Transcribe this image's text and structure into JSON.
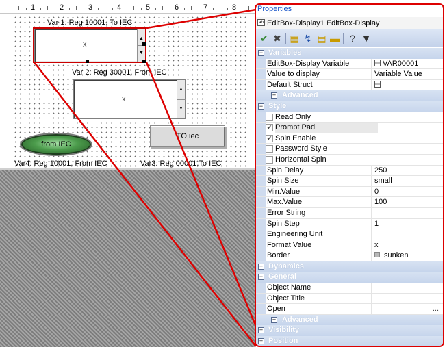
{
  "designer": {
    "ruler_numbers": [
      "1",
      "2",
      "3",
      "4",
      "5",
      "6",
      "7",
      "8"
    ],
    "var1_label": "Var 1: Reg 10001, To IEC",
    "var2_label": "Var 2: Reg 30001, From IEC",
    "var3_label": "Var3: Reg 00001,To IEC",
    "var4_label": "Var4: Reg 10001, From IEC",
    "editbox1_mark": "x",
    "editbox2_mark": "x",
    "from_iec_button": "from IEC",
    "to_iec_button": "TO iec"
  },
  "properties": {
    "title": "Properties",
    "object_name": "EditBox-Display1 EditBox-Display",
    "object_icon": "ab",
    "toolbar": [
      {
        "icon": "check-icon",
        "glyph": "✔",
        "color": "#3a8a3a"
      },
      {
        "icon": "delete-icon",
        "glyph": "✖",
        "color": "#444444"
      },
      {
        "icon": "categorized-icon",
        "glyph": "▦",
        "color": "#c89a00"
      },
      {
        "icon": "sort-icon",
        "glyph": "↯",
        "color": "#1f4fa8"
      },
      {
        "icon": "page-icon",
        "glyph": "▤",
        "color": "#c89a00"
      },
      {
        "icon": "comment-icon",
        "glyph": "▬",
        "color": "#c89a00"
      },
      {
        "icon": "help-icon",
        "glyph": "?",
        "color": "#333333"
      },
      {
        "icon": "filter-icon",
        "glyph": "▼",
        "color": "#333333"
      }
    ],
    "rows": [
      {
        "kind": "cat",
        "label": "Variables",
        "sign": "−"
      },
      {
        "kind": "prop",
        "name": "EditBox-Display Variable",
        "value": "VAR00001",
        "vicon": true
      },
      {
        "kind": "prop",
        "name": "Value to display",
        "value": "Variable Value"
      },
      {
        "kind": "prop",
        "name": "Default Struct",
        "value": "",
        "vicon": true
      },
      {
        "kind": "sub",
        "label": "Advanced",
        "sign": "+"
      },
      {
        "kind": "cat",
        "label": "Style",
        "sign": "−"
      },
      {
        "kind": "check",
        "name": "Read Only",
        "checked": false
      },
      {
        "kind": "check",
        "name": "Prompt Pad",
        "checked": true,
        "highlight": true
      },
      {
        "kind": "check",
        "name": "Spin Enable",
        "checked": true
      },
      {
        "kind": "check",
        "name": "Password Style",
        "checked": false
      },
      {
        "kind": "check",
        "name": "Horizontal Spin",
        "checked": false
      },
      {
        "kind": "prop",
        "name": "Spin Delay",
        "value": "250"
      },
      {
        "kind": "prop",
        "name": "Spin Size",
        "value": "small"
      },
      {
        "kind": "prop",
        "name": "Min.Value",
        "value": "0"
      },
      {
        "kind": "prop",
        "name": "Max.Value",
        "value": "100"
      },
      {
        "kind": "prop",
        "name": "Error String",
        "value": ""
      },
      {
        "kind": "prop",
        "name": "Spin Step",
        "value": "1"
      },
      {
        "kind": "prop",
        "name": "Engineering Unit",
        "value": ""
      },
      {
        "kind": "prop",
        "name": "Format Value",
        "value": "x"
      },
      {
        "kind": "prop",
        "name": "Border",
        "value": "sunken",
        "bicon": true
      },
      {
        "kind": "cat",
        "label": "Dynamics",
        "sign": "+"
      },
      {
        "kind": "cat",
        "label": "General",
        "sign": "−"
      },
      {
        "kind": "prop",
        "name": "Object Name",
        "value": ""
      },
      {
        "kind": "prop",
        "name": "Object Title",
        "value": ""
      },
      {
        "kind": "prop",
        "name": "Open",
        "value": "",
        "ellipsis": "..."
      },
      {
        "kind": "sub",
        "label": "Advanced",
        "sign": "+"
      },
      {
        "kind": "cat",
        "label": "Visibility",
        "sign": "+"
      },
      {
        "kind": "cat",
        "label": "Position",
        "sign": "+"
      }
    ]
  },
  "colors": {
    "highlight_red": "#dd0000",
    "category_band": "#c6d5ec",
    "title_blue": "#1a56c9"
  }
}
